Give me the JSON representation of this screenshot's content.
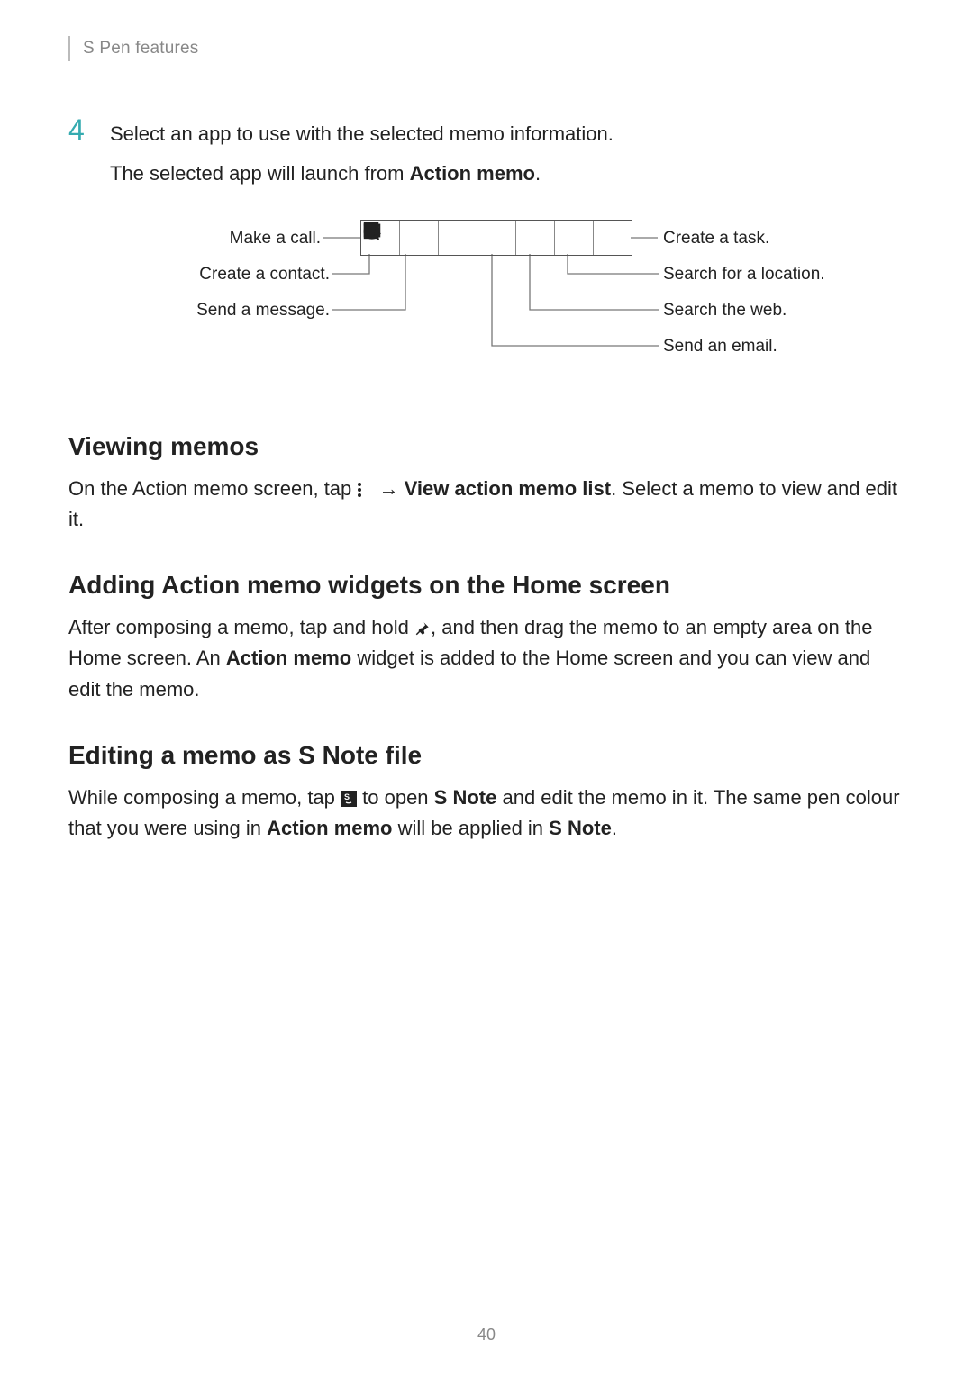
{
  "header": {
    "chapter": "S Pen features"
  },
  "step": {
    "number": "4",
    "line1": "Select an app to use with the selected memo information.",
    "line2_pre": "The selected app will launch from ",
    "line2_bold": "Action memo",
    "line2_post": "."
  },
  "diagram": {
    "labels": {
      "makeCall": "Make a call.",
      "createContact": "Create a contact.",
      "sendMessage": "Send a message.",
      "createTask": "Create a task.",
      "searchLocation": "Search for a location.",
      "searchWeb": "Search the web.",
      "sendEmail": "Send an email."
    },
    "icons": {
      "phone": "phone-icon",
      "contact": "contact-icon",
      "message": "message-icon",
      "at": "at-icon",
      "web": "web-icon",
      "location": "location-icon",
      "task": "task-icon"
    }
  },
  "sections": {
    "viewing": {
      "title": "Viewing memos",
      "p1_a": "On the Action memo screen, tap ",
      "p1_arrow": " → ",
      "p1_bold": "View action memo list",
      "p1_b": ". Select a memo to view and edit it."
    },
    "adding": {
      "title": "Adding Action memo widgets on the Home screen",
      "p1_a": "After composing a memo, tap and hold ",
      "p1_b": ", and then drag the memo to an empty area on the Home screen. An ",
      "p1_bold": "Action memo",
      "p1_c": " widget is added to the Home screen and you can view and edit the memo."
    },
    "editing": {
      "title": "Editing a memo as S Note file",
      "p1_a": "While composing a memo, tap ",
      "p1_b": " to open ",
      "p1_bold1": "S Note",
      "p1_c": " and edit the memo in it. The same pen colour that you were using in ",
      "p1_bold2": "Action memo",
      "p1_d": " will be applied in ",
      "p1_bold3": "S Note",
      "p1_e": "."
    }
  },
  "page_number": "40"
}
